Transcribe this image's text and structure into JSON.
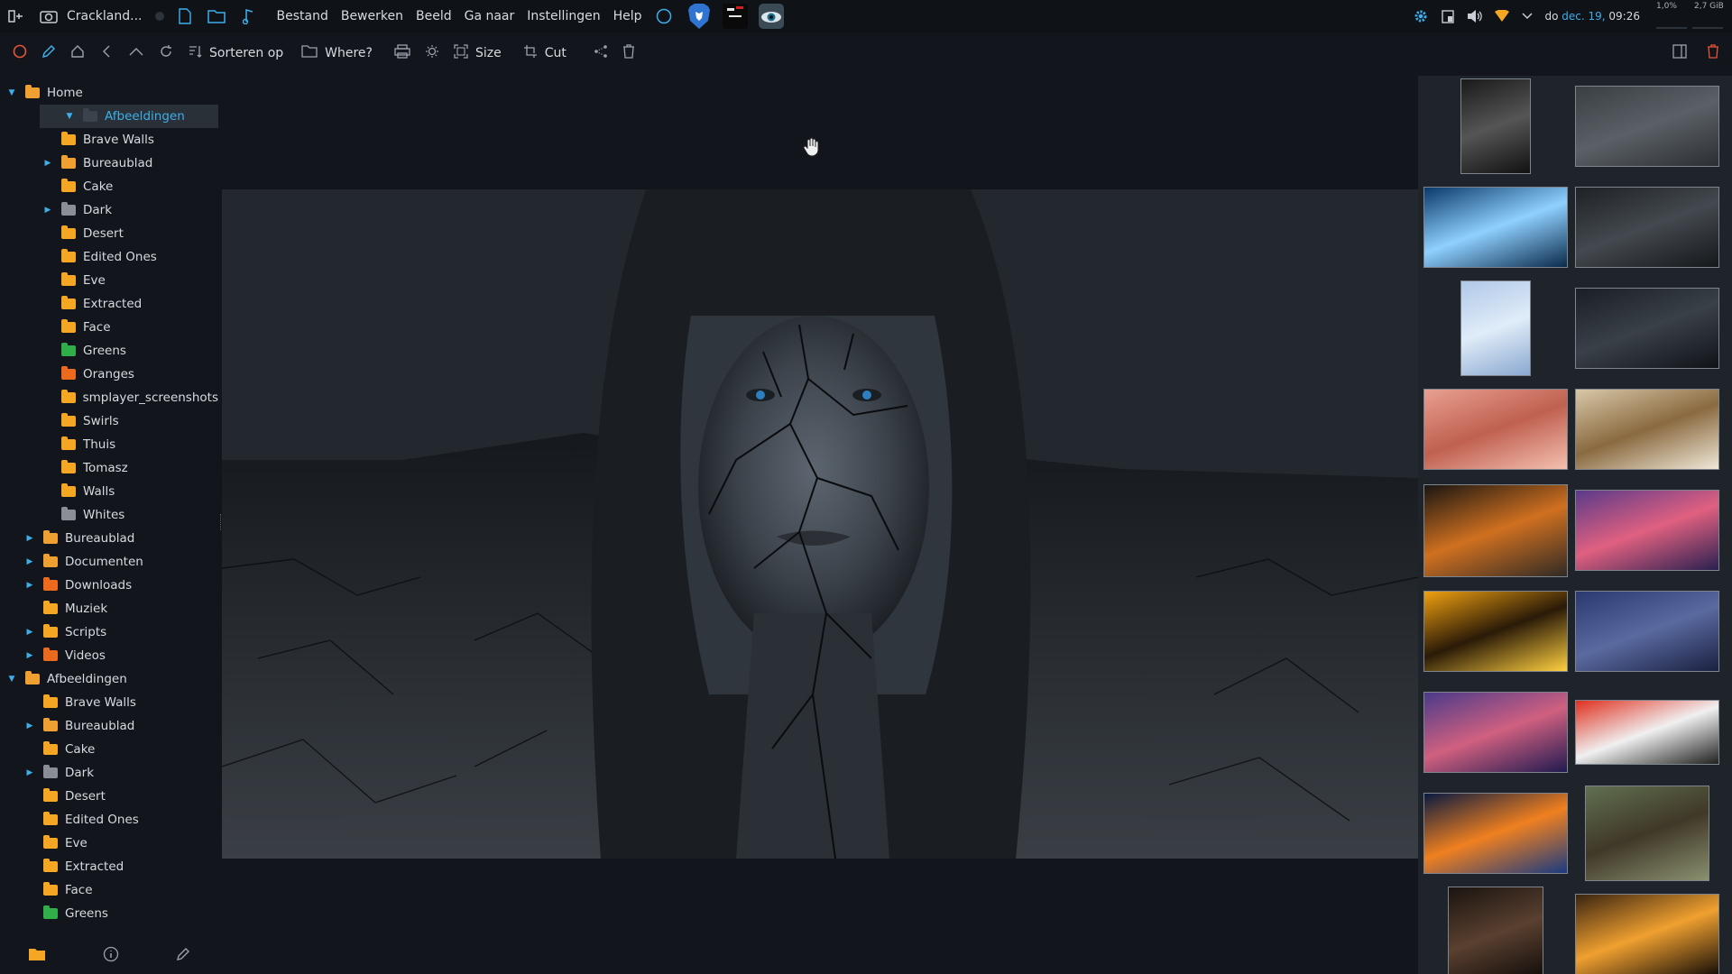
{
  "topbar": {
    "app_title": "Crackland...",
    "menu": [
      "Bestand",
      "Bewerken",
      "Beeld",
      "Ga naar",
      "Instellingen",
      "Help"
    ],
    "clock_prefix": "do",
    "clock_date": "dec. 19,",
    "clock_time": "09:26",
    "cpu": "1,0%",
    "mem": "2,7 GiB"
  },
  "toolbar": {
    "sort_label": "Sorteren op",
    "where_label": "Where?",
    "size_label": "Size",
    "cut_label": "Cut"
  },
  "tree": [
    {
      "label": "Home",
      "depth": 0,
      "arrow": "open",
      "color": "#f0a030"
    },
    {
      "label": "Afbeeldingen",
      "depth": 1,
      "arrow": "open",
      "color": "#3b424b",
      "selected": true
    },
    {
      "label": "Brave Walls",
      "depth": 2,
      "arrow": "",
      "color": "#f5a623"
    },
    {
      "label": "Bureaublad",
      "depth": 2,
      "arrow": "closed",
      "color": "#f0a030"
    },
    {
      "label": "Cake",
      "depth": 2,
      "arrow": "",
      "color": "#f5a623"
    },
    {
      "label": "Dark",
      "depth": 2,
      "arrow": "closed",
      "color": "#8a8f96"
    },
    {
      "label": "Desert",
      "depth": 2,
      "arrow": "",
      "color": "#f5a623"
    },
    {
      "label": "Edited Ones",
      "depth": 2,
      "arrow": "",
      "color": "#f5a623"
    },
    {
      "label": "Eve",
      "depth": 2,
      "arrow": "",
      "color": "#f5a623"
    },
    {
      "label": "Extracted",
      "depth": 2,
      "arrow": "",
      "color": "#f5a623"
    },
    {
      "label": "Face",
      "depth": 2,
      "arrow": "",
      "color": "#f5a623"
    },
    {
      "label": "Greens",
      "depth": 2,
      "arrow": "",
      "color": "#2fae4a"
    },
    {
      "label": "Oranges",
      "depth": 2,
      "arrow": "",
      "color": "#ec6a1e"
    },
    {
      "label": "smplayer_screenshots",
      "depth": 2,
      "arrow": "",
      "color": "#f5a623"
    },
    {
      "label": "Swirls",
      "depth": 2,
      "arrow": "",
      "color": "#f5a623"
    },
    {
      "label": "Thuis",
      "depth": 2,
      "arrow": "",
      "color": "#f5a623"
    },
    {
      "label": "Tomasz",
      "depth": 2,
      "arrow": "",
      "color": "#f5a623"
    },
    {
      "label": "Walls",
      "depth": 2,
      "arrow": "",
      "color": "#f5a623"
    },
    {
      "label": "Whites",
      "depth": 2,
      "arrow": "",
      "color": "#8a8f96"
    },
    {
      "label": "Bureaublad",
      "depth": 1,
      "arrow": "closed",
      "color": "#f0a030"
    },
    {
      "label": "Documenten",
      "depth": 1,
      "arrow": "closed",
      "color": "#f0a030"
    },
    {
      "label": "Downloads",
      "depth": 1,
      "arrow": "closed",
      "color": "#ec6a1e"
    },
    {
      "label": "Muziek",
      "depth": 1,
      "arrow": "",
      "color": "#f5a623"
    },
    {
      "label": "Scripts",
      "depth": 1,
      "arrow": "closed",
      "color": "#f5a623"
    },
    {
      "label": "Videos",
      "depth": 1,
      "arrow": "closed",
      "color": "#ec6a1e"
    },
    {
      "label": "Afbeeldingen",
      "depth": 0,
      "arrow": "open",
      "color": "#f0a030"
    },
    {
      "label": "Brave Walls",
      "depth": 1,
      "arrow": "",
      "color": "#f5a623"
    },
    {
      "label": "Bureaublad",
      "depth": 1,
      "arrow": "closed",
      "color": "#f0a030"
    },
    {
      "label": "Cake",
      "depth": 1,
      "arrow": "",
      "color": "#f5a623"
    },
    {
      "label": "Dark",
      "depth": 1,
      "arrow": "closed",
      "color": "#8a8f96"
    },
    {
      "label": "Desert",
      "depth": 1,
      "arrow": "",
      "color": "#f5a623"
    },
    {
      "label": "Edited Ones",
      "depth": 1,
      "arrow": "",
      "color": "#f5a623"
    },
    {
      "label": "Eve",
      "depth": 1,
      "arrow": "",
      "color": "#f5a623"
    },
    {
      "label": "Extracted",
      "depth": 1,
      "arrow": "",
      "color": "#f5a623"
    },
    {
      "label": "Face",
      "depth": 1,
      "arrow": "",
      "color": "#f5a623"
    },
    {
      "label": "Greens",
      "depth": 1,
      "arrow": "",
      "color": "#2fae4a"
    }
  ],
  "thumbnails": [
    {
      "name": "dark-interior",
      "colors": [
        "#1a1a1a",
        "#555",
        "#111"
      ]
    },
    {
      "name": "city-skyline",
      "colors": [
        "#3a3f44",
        "#5b6066",
        "#2b2f33"
      ]
    },
    {
      "name": "blue-clouds",
      "colors": [
        "#0a3a6a",
        "#8fd0ff",
        "#0a2a4a"
      ]
    },
    {
      "name": "hooded-face",
      "colors": [
        "#1e2226",
        "#44494f",
        "#15181b"
      ]
    },
    {
      "name": "blue-texture",
      "colors": [
        "#b0c8e8",
        "#e0ecf8",
        "#8aa8d0"
      ]
    },
    {
      "name": "umbrella-night",
      "colors": [
        "#1a1f25",
        "#3a4048",
        "#101419"
      ]
    },
    {
      "name": "ear-closeup",
      "colors": [
        "#e8a090",
        "#c06050",
        "#f4c0b0"
      ]
    },
    {
      "name": "bright-office",
      "colors": [
        "#d8c8a8",
        "#8a6a40",
        "#f0e8d8"
      ]
    },
    {
      "name": "bokeh-lights",
      "colors": [
        "#1a1612",
        "#d07020",
        "#302a24"
      ]
    },
    {
      "name": "purple-lake-boat",
      "colors": [
        "#5a3a8a",
        "#e06080",
        "#2a2050"
      ]
    },
    {
      "name": "orange-tabletop",
      "colors": [
        "#f0a010",
        "#2a1a08",
        "#ffd040"
      ]
    },
    {
      "name": "blue-lake-boat",
      "colors": [
        "#2a3a70",
        "#5a6aa0",
        "#1a2040"
      ]
    },
    {
      "name": "violet-lake-boat",
      "colors": [
        "#4a3a8a",
        "#d06080",
        "#201a50"
      ]
    },
    {
      "name": "comic-figures",
      "colors": [
        "#e03020",
        "#f0f0f0",
        "#202020"
      ]
    },
    {
      "name": "planet-sunrise",
      "colors": [
        "#0a1a40",
        "#f08020",
        "#1a3a80"
      ]
    },
    {
      "name": "painting-men",
      "colors": [
        "#607050",
        "#403828",
        "#8a9070"
      ]
    },
    {
      "name": "orangutan",
      "colors": [
        "#1a1410",
        "#5a4030",
        "#0e0a08"
      ]
    },
    {
      "name": "orange-corridor",
      "colors": [
        "#3a2410",
        "#f0a030",
        "#1a1008"
      ]
    }
  ]
}
